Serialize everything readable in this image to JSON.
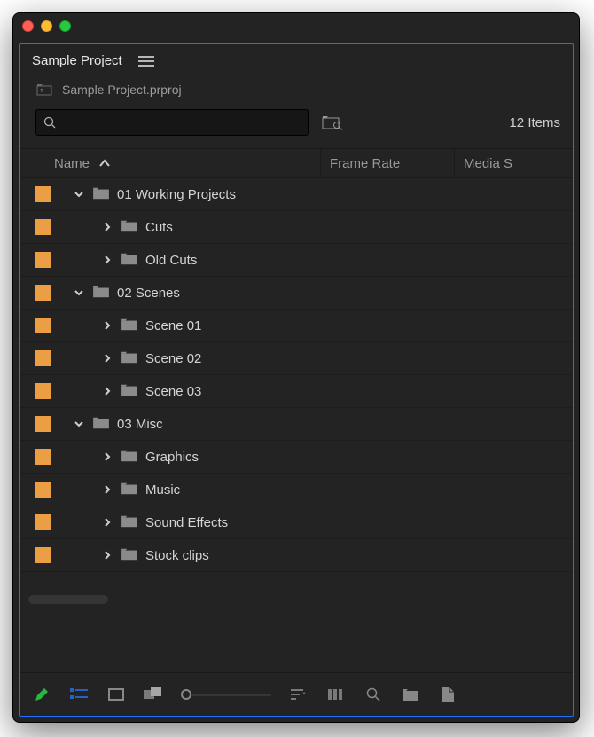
{
  "panel": {
    "title": "Sample Project",
    "project_file": "Sample Project.prproj",
    "item_count_label": "12 Items"
  },
  "search": {
    "placeholder": "",
    "value": ""
  },
  "columns": {
    "name": "Name",
    "frame_rate": "Frame Rate",
    "media_start": "Media S"
  },
  "rows": [
    {
      "label": "01 Working Projects",
      "depth": 0,
      "expanded": true
    },
    {
      "label": "Cuts",
      "depth": 1,
      "expanded": false
    },
    {
      "label": "Old Cuts",
      "depth": 1,
      "expanded": false
    },
    {
      "label": "02 Scenes",
      "depth": 0,
      "expanded": true
    },
    {
      "label": "Scene 01",
      "depth": 1,
      "expanded": false
    },
    {
      "label": "Scene 02",
      "depth": 1,
      "expanded": false
    },
    {
      "label": "Scene 03",
      "depth": 1,
      "expanded": false
    },
    {
      "label": "03 Misc",
      "depth": 0,
      "expanded": true
    },
    {
      "label": "Graphics",
      "depth": 1,
      "expanded": false
    },
    {
      "label": "Music",
      "depth": 1,
      "expanded": false
    },
    {
      "label": "Sound Effects",
      "depth": 1,
      "expanded": false
    },
    {
      "label": "Stock clips",
      "depth": 1,
      "expanded": false
    }
  ],
  "toolbar": {
    "pencil": "Write-enable toggle",
    "list_view": "List View",
    "icon_view": "Icon View",
    "freeform_view": "Freeform View",
    "zoom": "Thumbnail size",
    "sort": "Sort Icons",
    "automate": "Automate to Sequence",
    "find": "Find",
    "new_bin": "New Bin",
    "new_item": "New Item"
  },
  "colors": {
    "swatch": "#eb9e44",
    "accent_blue": "#206eff",
    "pencil_green": "#28d245"
  }
}
